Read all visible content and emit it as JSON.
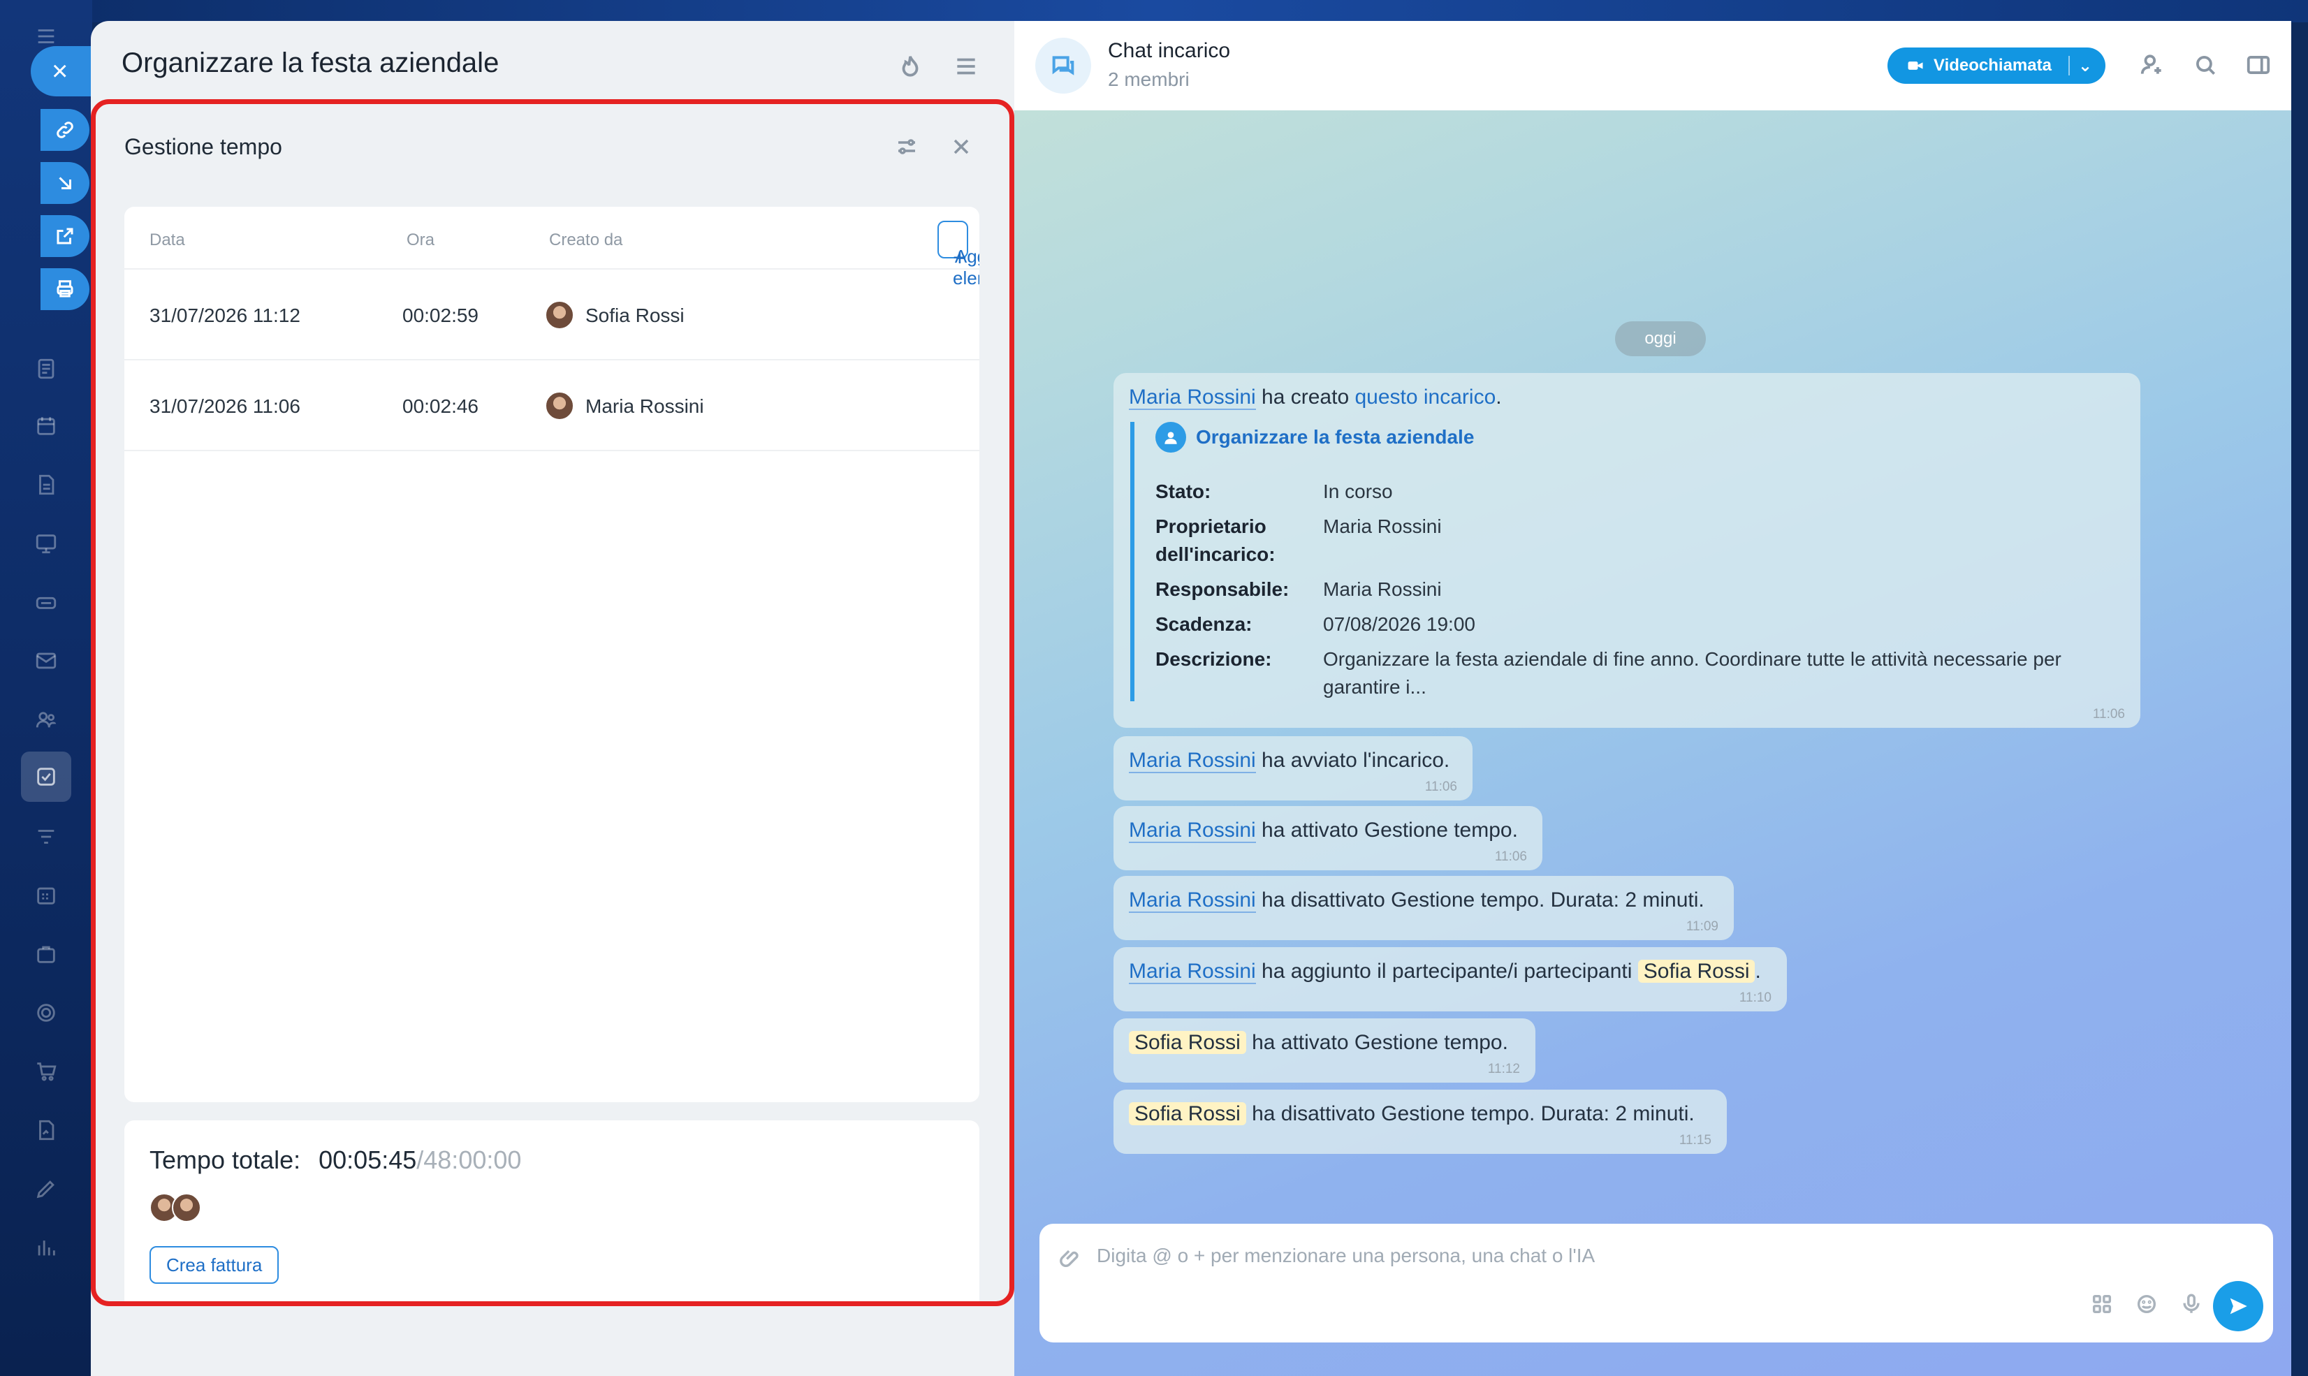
{
  "task": {
    "title": "Organizzare la festa aziendale"
  },
  "time_tracking": {
    "title": "Gestione tempo",
    "columns": {
      "date": "Data",
      "time": "Ora",
      "created_by": "Creato da"
    },
    "add_label": "Aggiungi elemento",
    "rows": [
      {
        "date": "31/07/2026 11:12",
        "time": "00:02:59",
        "user": "Sofia Rossi"
      },
      {
        "date": "31/07/2026 11:06",
        "time": "00:02:46",
        "user": "Maria Rossini"
      }
    ],
    "total_label": "Tempo totale:",
    "total_value": "00:05:45",
    "total_limit": "/48:00:00",
    "invoice_label": "Crea fattura"
  },
  "chat": {
    "name": "Chat incarico",
    "members": "2 membri",
    "video_label": "Videochiamata",
    "day": "oggi",
    "created": {
      "author": "Maria Rossini",
      "verb": " ha creato ",
      "link": "questo incarico",
      "end": ".",
      "card_title": "Organizzare la festa aziendale",
      "fields": {
        "status_k": "Stato:",
        "status_v": "In corso",
        "owner_k": "Proprietario dell'incarico:",
        "owner_v": "Maria Rossini",
        "resp_k": "Responsabile:",
        "resp_v": "Maria Rossini",
        "due_k": "Scadenza:",
        "due_v": "07/08/2026 19:00",
        "desc_k": "Descrizione:",
        "desc_v": "Organizzare la festa aziendale di fine anno. Coordinare tutte le attività necessarie per garantire i..."
      },
      "time": "11:06"
    },
    "messages": [
      {
        "author": "Maria Rossini",
        "text": " ha avviato l'incarico.",
        "time": "11:06"
      },
      {
        "author": "Maria Rossini",
        "text": " ha attivato Gestione tempo.",
        "time": "11:06"
      },
      {
        "author": "Maria Rossini",
        "text": " ha disattivato Gestione tempo. Durata: 2 minuti.",
        "time": "11:09"
      },
      {
        "author": "Maria Rossini",
        "text": " ha aggiunto il partecipante/i partecipanti ",
        "mention": "Sofia Rossi",
        "end": ".",
        "time": "11:10"
      },
      {
        "mention": "Sofia Rossi",
        "text": " ha attivato Gestione tempo.",
        "time": "11:12"
      },
      {
        "mention": "Sofia Rossi",
        "text": " ha disattivato Gestione tempo. Durata: 2 minuti.",
        "time": "11:15"
      }
    ],
    "composer_placeholder": "Digita @ o + per menzionare una persona, una chat o l'IA"
  }
}
